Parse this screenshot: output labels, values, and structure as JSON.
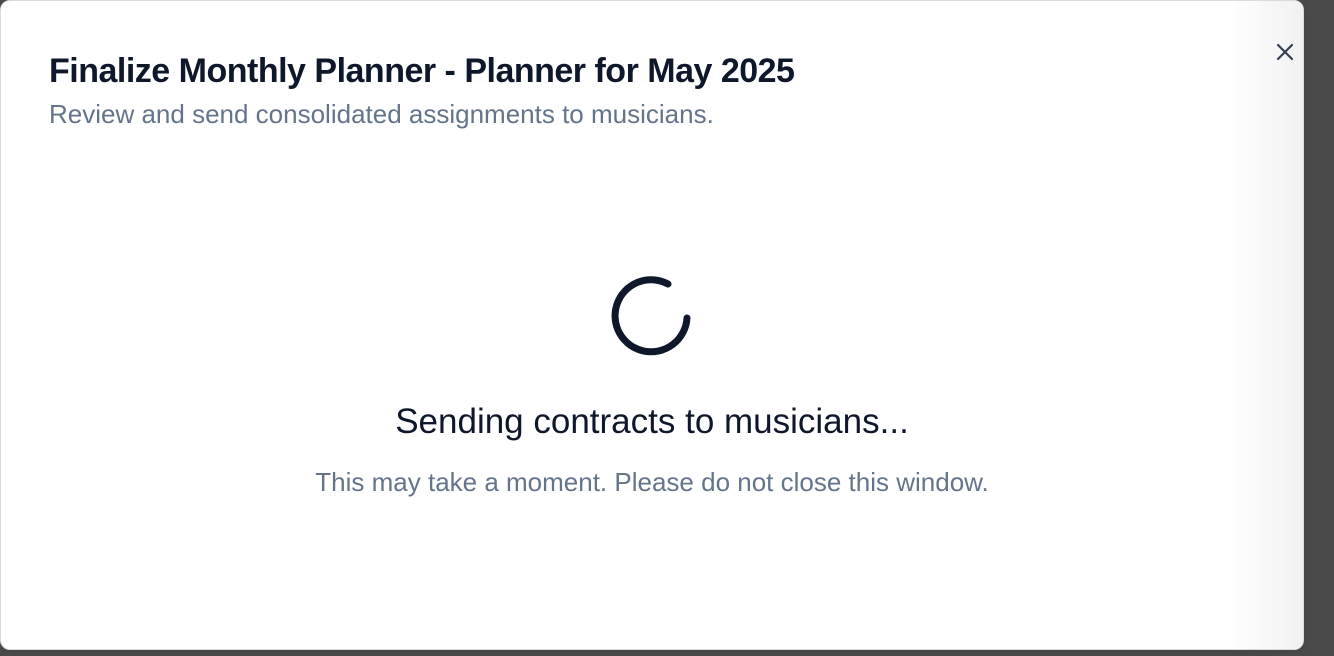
{
  "dialog": {
    "title": "Finalize Monthly Planner - Planner for May 2025",
    "subtitle": "Review and send consolidated assignments to musicians.",
    "close_icon": "close-icon"
  },
  "progress": {
    "spinner_icon": "loading-spinner-icon",
    "status": "Sending contracts to musicians...",
    "hint": "This may take a moment. Please do not close this window."
  },
  "colors": {
    "text_primary": "#0f172a",
    "text_muted": "#64748b",
    "spinner": "#0f172a"
  }
}
